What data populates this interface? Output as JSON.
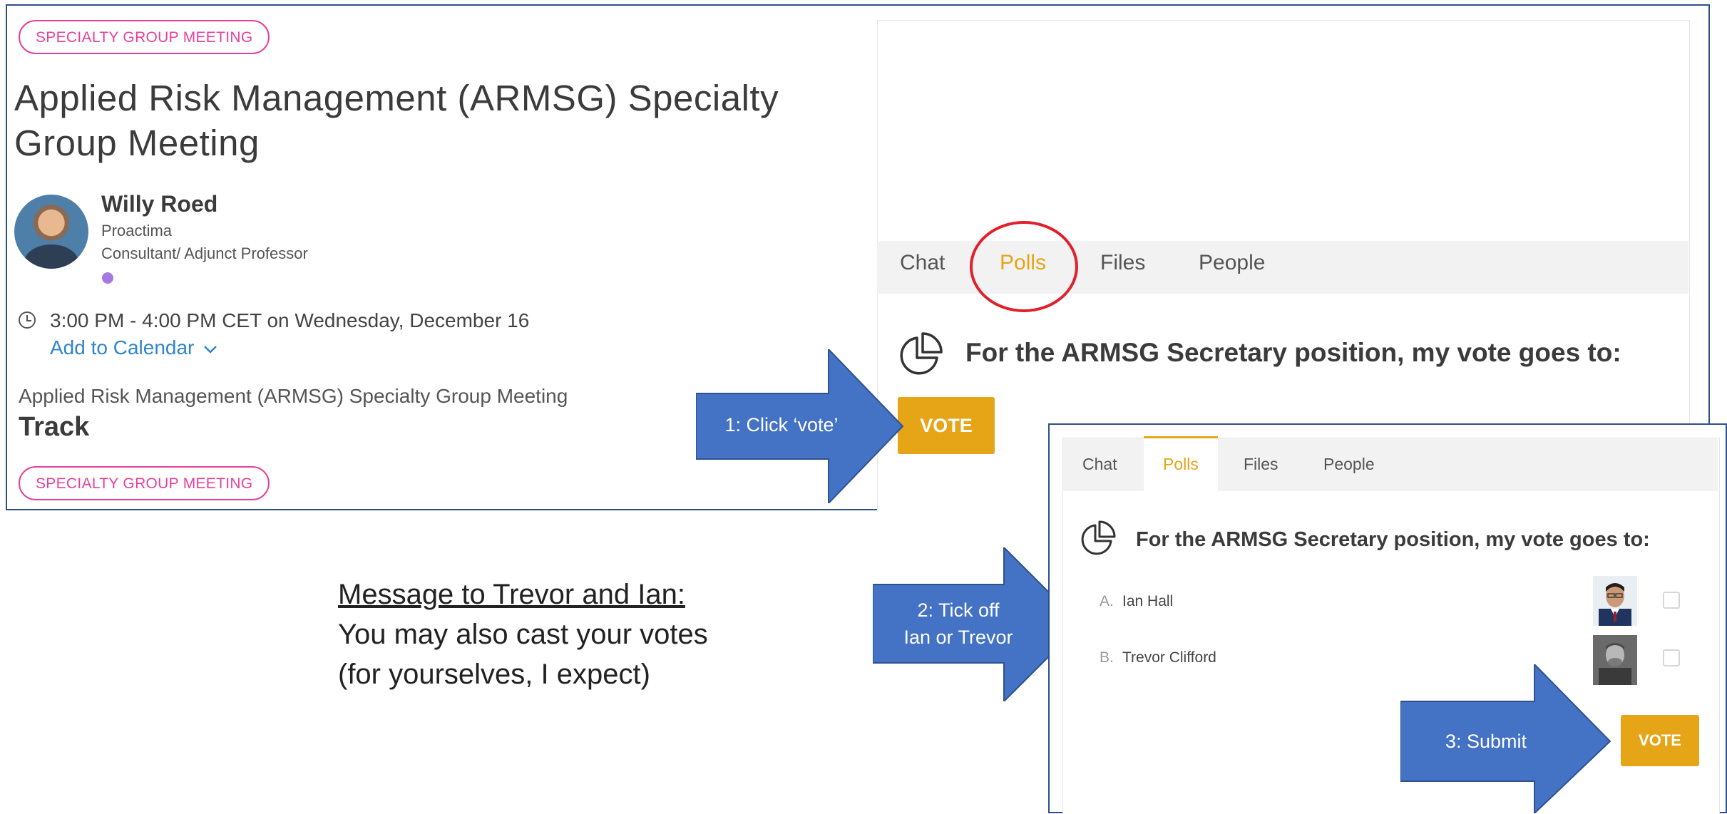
{
  "event": {
    "badge_top": "SPECIALTY GROUP MEETING",
    "title": "Applied Risk Management (ARMSG) Specialty Group Meeting",
    "speaker": {
      "name": "Willy Roed",
      "company": "Proactima",
      "role": "Consultant/ Adjunct Professor"
    },
    "time": "3:00 PM - 4:00 PM CET on Wednesday, December 16",
    "add_to_calendar": "Add to Calendar",
    "subtitle": "Applied Risk Management (ARMSG) Specialty Group Meeting",
    "track_label": "Track",
    "badge_bottom": "SPECIALTY GROUP MEETING"
  },
  "panel1": {
    "tabs": [
      "Chat",
      "Polls",
      "Files",
      "People"
    ],
    "active_tab": "Polls",
    "question": "For the ARMSG Secretary position, my vote goes to:",
    "vote_label": "VOTE"
  },
  "panel2": {
    "tabs": [
      "Chat",
      "Polls",
      "Files",
      "People"
    ],
    "active_tab": "Polls",
    "question": "For the ARMSG Secretary position, my vote goes to:",
    "options": [
      {
        "letter": "A.",
        "name": "Ian Hall"
      },
      {
        "letter": "B.",
        "name": "Trevor Clifford"
      }
    ],
    "vote_label": "VOTE"
  },
  "annotations": {
    "step1": "1: Click ‘vote’",
    "step2_line1": "2: Tick off",
    "step2_line2": "Ian or Trevor",
    "step3": "3: Submit"
  },
  "message": {
    "heading": "Message to Trevor and Ian:",
    "line1": "You may also cast your votes",
    "line2": "(for yourselves, I expect)"
  },
  "colors": {
    "accent": "#e5a516",
    "badge": "#e6409a",
    "arrow": "#4472c4",
    "highlight_circle": "#e0202a",
    "link": "#2f85c8"
  }
}
